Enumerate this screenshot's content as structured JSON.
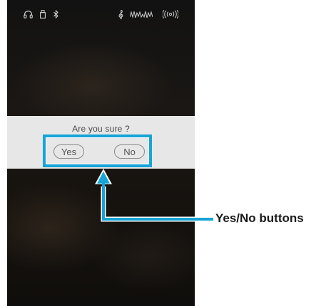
{
  "dialog": {
    "message": "Are you sure ?",
    "yes_label": "Yes",
    "no_label": "No"
  },
  "status_icons": [
    "headphones-icon",
    "usb-icon",
    "bluetooth-icon",
    "treble-clef-icon",
    "sound-wave-icon",
    "wireless-icon"
  ],
  "annotation": {
    "label": "Yes/No buttons",
    "color": "#17a4d6"
  },
  "colors": {
    "dialog_bg": "#e7e7e7",
    "screen_bg": "#151210"
  }
}
